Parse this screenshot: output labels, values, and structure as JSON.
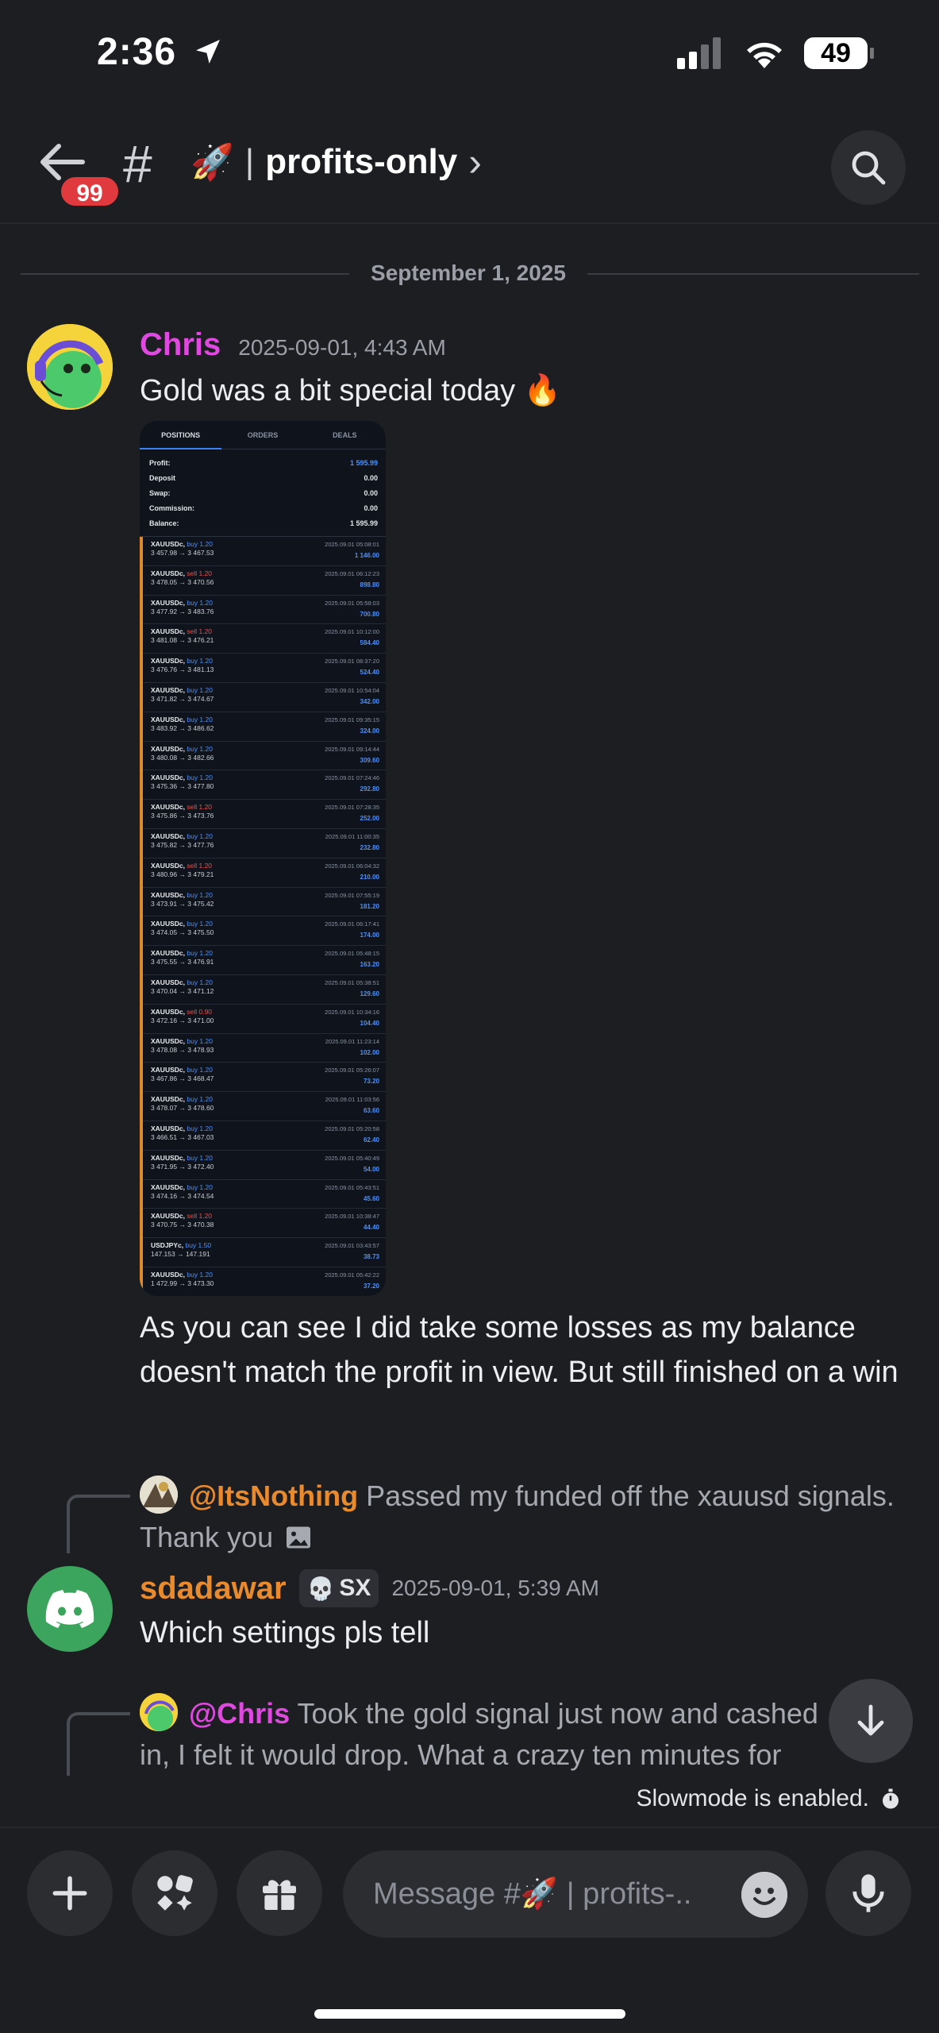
{
  "status_bar": {
    "time": "2:36",
    "battery": "49"
  },
  "header": {
    "badge": "99",
    "channel_emoji": "🚀",
    "channel_sep": "|",
    "channel_name": "profits-only",
    "chevron": "›"
  },
  "date_divider": "September 1, 2025",
  "message1": {
    "author": "Chris",
    "author_color": "#e049e0",
    "timestamp": "2025-09-01, 4:43 AM",
    "text1": "Gold was a bit special today 🔥",
    "text2": "As you can see I did take some losses as my balance doesn't match the profit in view. But still finished on a win"
  },
  "attachment": {
    "tabs": [
      "POSITIONS",
      "ORDERS",
      "DEALS"
    ],
    "summary": [
      {
        "label": "Profit:",
        "value": "1 595.99"
      },
      {
        "label": "Deposit",
        "value": "0.00"
      },
      {
        "label": "Swap:",
        "value": "0.00"
      },
      {
        "label": "Commission:",
        "value": "0.00"
      },
      {
        "label": "Balance:",
        "value": "1 595.99"
      }
    ],
    "trades": [
      {
        "sym": "XAUUSDc",
        "dir": "buy 1.20",
        "prices": "3 457.98 → 3 467.53",
        "date": "2025.09.01 05:08:01",
        "profit": "1 146.00"
      },
      {
        "sym": "XAUUSDc",
        "dir": "sell 1.20",
        "prices": "3 478.05 → 3 470.56",
        "date": "2025.09.01 06:12:23",
        "profit": "898.80"
      },
      {
        "sym": "XAUUSDc",
        "dir": "buy 1.20",
        "prices": "3 477.92 → 3 483.76",
        "date": "2025.09.01 05:58:03",
        "profit": "700.80"
      },
      {
        "sym": "XAUUSDc",
        "dir": "sell 1.20",
        "prices": "3 481.08 → 3 476.21",
        "date": "2025.09.01 10:12:00",
        "profit": "584.40"
      },
      {
        "sym": "XAUUSDc",
        "dir": "buy 1.20",
        "prices": "3 476.76 → 3 481.13",
        "date": "2025.09.01 08:37:20",
        "profit": "524.40"
      },
      {
        "sym": "XAUUSDc",
        "dir": "buy 1.20",
        "prices": "3 471.82 → 3 474.67",
        "date": "2025.09.01 10:54:04",
        "profit": "342.00"
      },
      {
        "sym": "XAUUSDc",
        "dir": "buy 1.20",
        "prices": "3 483.92 → 3 486.62",
        "date": "2025.09.01 09:35:15",
        "profit": "324.00"
      },
      {
        "sym": "XAUUSDc",
        "dir": "buy 1.20",
        "prices": "3 480.08 → 3 482.66",
        "date": "2025.09.01 09:14:44",
        "profit": "309.60"
      },
      {
        "sym": "XAUUSDc",
        "dir": "buy 1.20",
        "prices": "3 475.36 → 3 477.80",
        "date": "2025.09.01 07:24:46",
        "profit": "292.80"
      },
      {
        "sym": "XAUUSDc",
        "dir": "sell 1.20",
        "prices": "3 475.86 → 3 473.76",
        "date": "2025.09.01 07:28:35",
        "profit": "252.00"
      },
      {
        "sym": "XAUUSDc",
        "dir": "buy 1.20",
        "prices": "3 475.82 → 3 477.76",
        "date": "2025.09.01 11:00:35",
        "profit": "232.80"
      },
      {
        "sym": "XAUUSDc",
        "dir": "sell 1.20",
        "prices": "3 480.96 → 3 479.21",
        "date": "2025.09.01 06:04:32",
        "profit": "210.00"
      },
      {
        "sym": "XAUUSDc",
        "dir": "buy 1.20",
        "prices": "3 473.91 → 3 475.42",
        "date": "2025.09.01 07:55:19",
        "profit": "181.20"
      },
      {
        "sym": "XAUUSDc",
        "dir": "buy 1.20",
        "prices": "3 474.05 → 3 475.50",
        "date": "2025.09.01 06:17:41",
        "profit": "174.00"
      },
      {
        "sym": "XAUUSDc",
        "dir": "buy 1.20",
        "prices": "3 475.55 → 3 476.91",
        "date": "2025.09.01 05:48:15",
        "profit": "163.20"
      },
      {
        "sym": "XAUUSDc",
        "dir": "buy 1.20",
        "prices": "3 470.04 → 3 471.12",
        "date": "2025.09.01 05:38:51",
        "profit": "129.60"
      },
      {
        "sym": "XAUUSDc",
        "dir": "sell 0.90",
        "prices": "3 472.16 → 3 471.00",
        "date": "2025.09.01 10:34:16",
        "profit": "104.40"
      },
      {
        "sym": "XAUUSDc",
        "dir": "buy 1.20",
        "prices": "3 478.08 → 3 478.93",
        "date": "2025.09.01 11:23:14",
        "profit": "102.00"
      },
      {
        "sym": "XAUUSDc",
        "dir": "buy 1.20",
        "prices": "3 467.86 → 3 468.47",
        "date": "2025.09.01 05:26:07",
        "profit": "73.20"
      },
      {
        "sym": "XAUUSDc",
        "dir": "buy 1.20",
        "prices": "3 478.07 → 3 478.60",
        "date": "2025.09.01 11:03:56",
        "profit": "63.60"
      },
      {
        "sym": "XAUUSDc",
        "dir": "buy 1.20",
        "prices": "3 466.51 → 3 467.03",
        "date": "2025.09.01 05:20:58",
        "profit": "62.40"
      },
      {
        "sym": "XAUUSDc",
        "dir": "buy 1.20",
        "prices": "3 471.95 → 3 472.40",
        "date": "2025.09.01 05:40:49",
        "profit": "54.00"
      },
      {
        "sym": "XAUUSDc",
        "dir": "buy 1.20",
        "prices": "3 474.16 → 3 474.54",
        "date": "2025.09.01 05:43:51",
        "profit": "45.60"
      },
      {
        "sym": "XAUUSDc",
        "dir": "sell 1.20",
        "prices": "3 470.75 → 3 470.38",
        "date": "2025.09.01 10:38:47",
        "profit": "44.40"
      },
      {
        "sym": "USDJPYc",
        "dir": "buy 1.50",
        "prices": "147.153 → 147.191",
        "date": "2025.09.01 03:43:57",
        "profit": "38.73"
      },
      {
        "sym": "XAUUSDc",
        "dir": "buy 1.20",
        "prices": "1 472.99 → 3 473.30",
        "date": "2025.09.01 05:42:22",
        "profit": "37.20"
      }
    ]
  },
  "reply1": {
    "mention": "@ItsNothing",
    "mention_color": "#e98a2d",
    "text": "Passed my funded off the xauusd signals. Thank you"
  },
  "message2": {
    "author": "sdadawar",
    "author_color": "#e98a2d",
    "role_tag": "SX",
    "timestamp": "2025-09-01, 5:39 AM",
    "text": "Which settings pls tell"
  },
  "reply2": {
    "mention": "@Chris",
    "mention_color": "#e049e0",
    "text": "Took the gold signal just now and cashed in, I felt it would drop. What a crazy ten minutes for me haha"
  },
  "slowmode": "Slowmode is enabled.",
  "composer": {
    "placeholder": "Message #🚀 | profits-.."
  },
  "colors": {
    "background": "#1d1e22",
    "discord_green": "#3ba55d",
    "badge_red": "#e03a3e"
  }
}
